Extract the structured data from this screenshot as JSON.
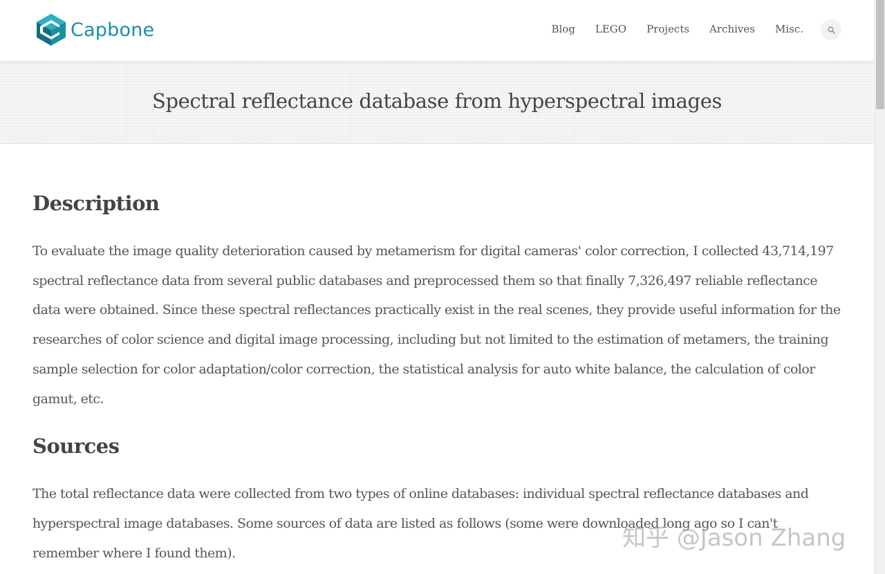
{
  "brand": {
    "name": "Capbone",
    "color": "#1a8fa3"
  },
  "nav": {
    "items": [
      {
        "label": "Blog"
      },
      {
        "label": "LEGO"
      },
      {
        "label": "Projects"
      },
      {
        "label": "Archives"
      },
      {
        "label": "Misc."
      }
    ],
    "search_icon": "search-icon"
  },
  "page": {
    "title": "Spectral reflectance database from hyperspectral images"
  },
  "sections": [
    {
      "heading": "Description",
      "body": "To evaluate the image quality deterioration caused by metamerism for digital cameras' color correction, I collected 43,714,197 spectral reflectance data from several public databases and preprocessed them so that finally 7,326,497 reliable reflectance data were obtained. Since these spectral reflectances practically exist in the real scenes, they provide useful information for the researches of color science and digital image processing, including but not limited to the estimation of metamers, the training sample selection for color adaptation/color correction, the statistical analysis for auto white balance, the calculation of color gamut, etc."
    },
    {
      "heading": "Sources",
      "body": "The total reflectance data were collected from two types of online databases: individual spectral reflectance databases and hyperspectral image databases. Some sources of data are listed as follows (some were downloaded long ago so I can't remember where I found them)."
    }
  ],
  "watermark": {
    "text": "知乎 @Jason Zhang"
  },
  "colors": {
    "text": "#555555",
    "heading": "#444444",
    "band": "#f7f7f7"
  }
}
